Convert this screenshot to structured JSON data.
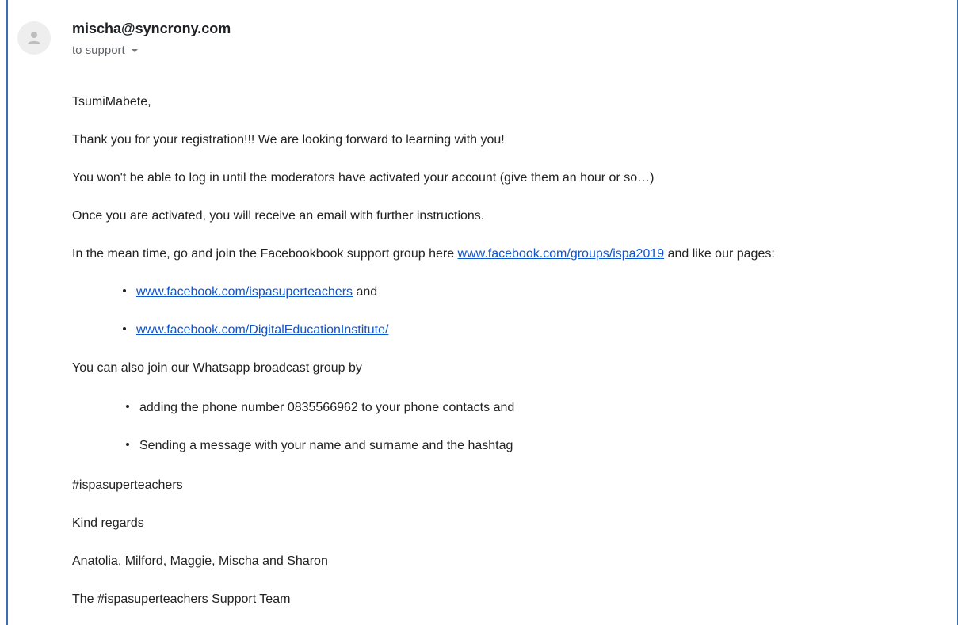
{
  "email": {
    "sender": "mischa@syncrony.com",
    "recipient": "to support"
  },
  "body": {
    "greeting": "TsumiMabete,",
    "p1": "Thank you for your registration!!! We are looking forward to learning with you!",
    "p2": "You won't be able to log in until the moderators have activated your account (give them an hour or so…)",
    "p3": "Once you are activated, you will receive an email with further instructions.",
    "p4_before": "In the mean time, go and join the Facebookbook support group here ",
    "p4_link": "www.facebook.com/groups/ispa2019",
    "p4_after": " and like our pages:",
    "fb_bullets": [
      {
        "link": "www.facebook.com/ispasuperteachers",
        "suffix": " and"
      },
      {
        "link": "www.facebook.com/DigitalEducationInstitute/",
        "suffix": ""
      }
    ],
    "p5": "You can also join our Whatsapp broadcast group by",
    "wa_bullets": [
      "adding the phone number 0835566962 to your phone contacts and",
      "Sending a message with your name and surname and the hashtag"
    ],
    "hashtag": "#ispasuperteachers",
    "closing": "Kind regards",
    "names": "Anatolia, Milford, Maggie, Mischa and Sharon",
    "team": "The #ispasuperteachers Support Team"
  }
}
